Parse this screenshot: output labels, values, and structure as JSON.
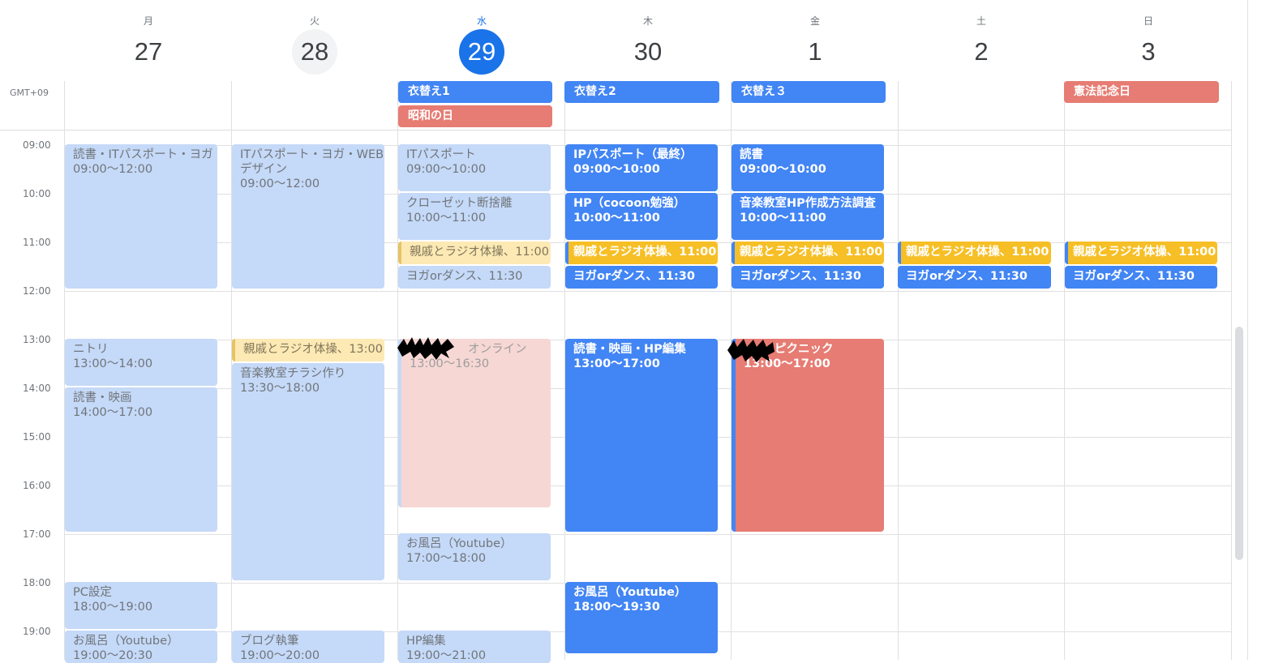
{
  "header": {
    "days": [
      {
        "dow": "月",
        "num": "27"
      },
      {
        "dow": "火",
        "num": "28"
      },
      {
        "dow": "水",
        "num": "29"
      },
      {
        "dow": "木",
        "num": "30"
      },
      {
        "dow": "金",
        "num": "1"
      },
      {
        "dow": "土",
        "num": "2"
      },
      {
        "dow": "日",
        "num": "3"
      }
    ],
    "timezone": "GMT+09"
  },
  "all_day": [
    "衣替え1",
    "昭和の日",
    "衣替え2",
    "衣替え３",
    "憲法記念日"
  ],
  "times": [
    "09:00",
    "10:00",
    "11:00",
    "12:00",
    "13:00",
    "14:00",
    "15:00",
    "16:00",
    "17:00",
    "18:00",
    "19:00"
  ],
  "events": {
    "mon": [
      {
        "title": "読書・ITパスポート・ヨガ",
        "time": "09:00〜12:00"
      },
      {
        "title": "ニトリ",
        "time": "13:00〜14:00"
      },
      {
        "title": "読書・映画",
        "time": "14:00〜17:00"
      },
      {
        "title": "PC設定",
        "time": "18:00〜19:00"
      },
      {
        "title": "お風呂（Youtube）",
        "time": "19:00〜20:30"
      }
    ],
    "tue": [
      {
        "title": "ITパスポート・ヨガ・WEBデザイン",
        "time": "09:00〜12:00"
      },
      {
        "title": "親戚とラジオ体操、13:00"
      },
      {
        "title": "音楽教室チラシ作り",
        "time": "13:30〜18:00"
      },
      {
        "title": "ブログ執筆",
        "time": "19:00〜20:00"
      }
    ],
    "wed": [
      {
        "title": "ITパスポート",
        "time": "09:00〜10:00"
      },
      {
        "title": "クローゼット断捨離",
        "time": "10:00〜11:00"
      },
      {
        "title": "親戚とラジオ体操、11:00"
      },
      {
        "title": "ヨガorダンス、11:30"
      },
      {
        "title": "オンライン",
        "time": "13:00〜16:30"
      },
      {
        "title": "お風呂（Youtube）",
        "time": "17:00〜18:00"
      },
      {
        "title": "HP編集",
        "time": "19:00〜21:00"
      }
    ],
    "thu": [
      {
        "title": "IPパスポート（最終）",
        "time": "09:00〜10:00"
      },
      {
        "title": "HP（cocoon勉強）",
        "time": "10:00〜11:00"
      },
      {
        "title": "親戚とラジオ体操、11:00"
      },
      {
        "title": "ヨガorダンス、11:30"
      },
      {
        "title": "読書・映画・HP編集",
        "time": "13:00〜17:00"
      },
      {
        "title": "お風呂（Youtube）",
        "time": "18:00〜19:30"
      }
    ],
    "fri": [
      {
        "title": "読書",
        "time": "09:00〜10:00"
      },
      {
        "title": "音楽教室HP作成方法調査",
        "time": "10:00〜11:00"
      },
      {
        "title": "親戚とラジオ体操、11:00"
      },
      {
        "title": "ヨガorダンス、11:30"
      },
      {
        "title": "ピクニック",
        "time": "13:00〜17:00"
      }
    ],
    "sat": [
      {
        "title": "親戚とラジオ体操、11:00"
      },
      {
        "title": "ヨガorダンス、11:30"
      }
    ],
    "sun": [
      {
        "title": "親戚とラジオ体操、11:00"
      },
      {
        "title": "ヨガorダンス、11:30"
      }
    ]
  },
  "colors": {
    "today": "#1a73e8",
    "event_blue": "#4285f4",
    "event_past": "#c5d9f8",
    "holiday_red": "#e67c73",
    "event_yellow": "#f6bf26"
  }
}
